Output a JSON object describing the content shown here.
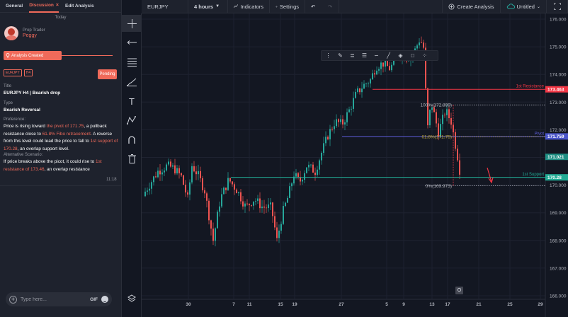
{
  "panel": {
    "tabs": [
      "General",
      "Discussion",
      "Edit Analysis"
    ],
    "close_glyph": "×",
    "today": "Today",
    "role": "Prop Trader",
    "user_name": "Peggy",
    "created_label": "Analysis Created",
    "chips": [
      "EURJPY",
      "H4"
    ],
    "status": "Pending",
    "title_label": "Title",
    "title_value": "EURJPY H4 | Bearish drop",
    "type_label": "Type",
    "type_value": "Bearish Reversal",
    "pref_label": "Preference:",
    "pref_parts": [
      {
        "t": "Price is rising toward ",
        "h": false
      },
      {
        "t": "the pivot of 171.75",
        "h": true
      },
      {
        "t": ", a pullback resistance close to ",
        "h": false
      },
      {
        "t": "61.8% Fibo retracement",
        "h": true
      },
      {
        "t": ". A reverse from this level could lead the price to fall to ",
        "h": false
      },
      {
        "t": "1st support of 170.28",
        "h": true
      },
      {
        "t": ", an overlap support level.",
        "h": false
      }
    ],
    "alt_label": "Alternative Scenario:",
    "alt_parts": [
      {
        "t": "If price breaks above the picot, it could rise to ",
        "h": false
      },
      {
        "t": "1st resistance of 173.46",
        "h": true
      },
      {
        "t": ", an overlap resistance",
        "h": false
      }
    ],
    "time": "11:18",
    "input_placeholder": "Type here...",
    "gif_label": "GIF"
  },
  "toolbar": {
    "symbol": "EURJPY",
    "interval": "4 hours",
    "indicators": "Indicators",
    "settings": "Settings",
    "create_analysis": "Create Analysis",
    "layout_name": "Untitled"
  },
  "colors": {
    "accent": "#f06a5a",
    "bull": "#26a69a",
    "bear": "#ef5350",
    "resistance": "#f23645",
    "pivot": "#5b5bd6",
    "support": "#22ab94",
    "pivot_badge": "#4a55c9",
    "last_price": "#1f8f84"
  },
  "icons": {
    "drawing_tools": [
      "crosshair-icon",
      "trend-line-icon",
      "horizontal-lines-icon",
      "brush-icon",
      "text-icon",
      "pattern-icon",
      "magnet-icon",
      "trash-icon",
      "layers-icon"
    ],
    "float_tools": [
      "drag-handle-icon",
      "pencil-icon",
      "align-icon",
      "template-icon",
      "line-style-icon",
      "thickness-icon",
      "fill-icon",
      "settings-icon",
      "more-icon"
    ]
  },
  "chart_data": {
    "type": "candlestick",
    "symbol": "EURJPY",
    "timeframe": "H4",
    "y_ticks": [
      "176.000",
      "175.000",
      "174.000",
      "173.000",
      "172.000",
      "171.000",
      "170.000",
      "169.000",
      "168.000",
      "167.000",
      "166.000"
    ],
    "x_ticks": [
      "30",
      "7",
      "11",
      "15",
      "19",
      "27",
      "5",
      "9",
      "13",
      "17",
      "21",
      "25",
      "29"
    ],
    "price_levels": [
      {
        "name": "1st Resistance",
        "value": 173.463,
        "label": "173.463"
      },
      {
        "name": "Pivot",
        "value": 171.759,
        "label": "171.759"
      },
      {
        "name": "1st Support",
        "value": 170.28,
        "label": "170.28"
      }
    ],
    "last_price": {
      "value": 171.021,
      "label": "171.021"
    },
    "fibonacci": [
      {
        "label": "100%(172.899)",
        "value": 172.899
      },
      {
        "label": "61.8%(171.75)",
        "value": 171.75
      },
      {
        "label": "0%(169.973)",
        "value": 169.973
      }
    ],
    "path": [
      [
        0,
        169.6
      ],
      [
        12,
        170.1
      ],
      [
        22,
        170.5
      ],
      [
        35,
        170.7
      ],
      [
        45,
        170.6
      ],
      [
        55,
        170.3
      ],
      [
        64,
        169.5
      ],
      [
        70,
        170.7
      ],
      [
        78,
        170.4
      ],
      [
        88,
        169.8
      ],
      [
        100,
        168.0
      ],
      [
        110,
        169.5
      ],
      [
        122,
        170.2
      ],
      [
        134,
        169.8
      ],
      [
        146,
        169.2
      ],
      [
        158,
        169.5
      ],
      [
        170,
        169.2
      ],
      [
        182,
        169.2
      ],
      [
        190,
        168.0
      ],
      [
        198,
        169.0
      ],
      [
        206,
        169.6
      ],
      [
        214,
        170.4
      ],
      [
        222,
        170.1
      ],
      [
        232,
        170.7
      ],
      [
        244,
        170.5
      ],
      [
        252,
        171.1
      ],
      [
        262,
        171.8
      ],
      [
        272,
        172.3
      ],
      [
        282,
        172.2
      ],
      [
        292,
        172.7
      ],
      [
        302,
        173.3
      ],
      [
        312,
        173.6
      ],
      [
        322,
        173.8
      ],
      [
        330,
        174.3
      ],
      [
        340,
        174.4
      ],
      [
        350,
        174.2
      ],
      [
        362,
        174.8
      ],
      [
        372,
        174.6
      ],
      [
        382,
        174.7
      ],
      [
        392,
        175.3
      ],
      [
        398,
        174.9
      ],
      [
        402,
        171.9
      ],
      [
        408,
        173.0
      ],
      [
        418,
        171.9
      ],
      [
        428,
        172.7
      ],
      [
        436,
        172.3
      ],
      [
        446,
        170.9
      ],
      [
        450,
        170.2
      ]
    ]
  }
}
